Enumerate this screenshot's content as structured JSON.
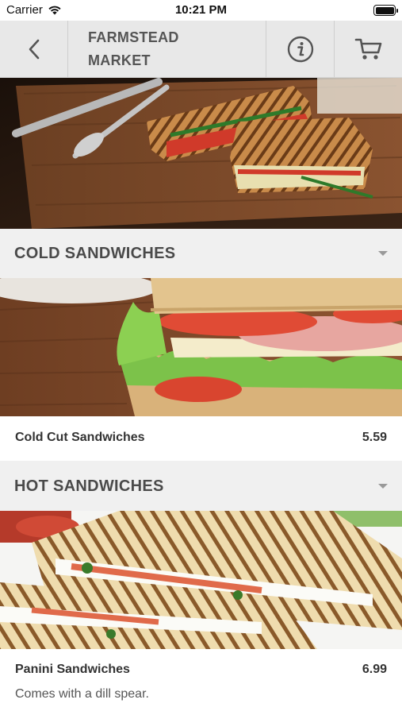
{
  "status_bar": {
    "carrier": "Carrier",
    "time": "10:21 PM"
  },
  "nav": {
    "title": "FARMSTEAD MARKET",
    "icons": [
      "back-chevron",
      "info",
      "cart"
    ]
  },
  "categories": [
    {
      "title": "COLD SANDWICHES",
      "items": [
        {
          "name": "Cold Cut Sandwiches",
          "price": "5.59",
          "description": ""
        }
      ]
    },
    {
      "title": "HOT SANDWICHES",
      "items": [
        {
          "name": "Panini Sandwiches",
          "price": "6.99",
          "description": "Comes with a dill spear."
        }
      ]
    }
  ],
  "colors": {
    "nav_bg": "#e8e8e8",
    "page_bg": "#f0f0f0",
    "text": "#333333"
  }
}
